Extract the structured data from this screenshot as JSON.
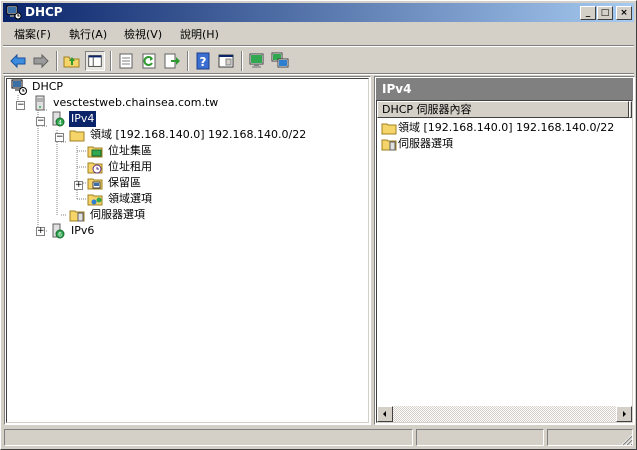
{
  "window": {
    "title": "DHCP",
    "controls": {
      "minimize": "_",
      "maximize": "□",
      "close": "×"
    }
  },
  "menu": [
    "檔案(F)",
    "執行(A)",
    "檢視(V)",
    "說明(H)"
  ],
  "toolbar": {
    "icons": [
      "back-arrow-icon",
      "forward-arrow-icon",
      "up-folder-icon",
      "show-tree-icon",
      "properties-icon",
      "refresh-icon",
      "export-icon",
      "help-icon",
      "console-tree-icon",
      "server-icon",
      "network-icon"
    ]
  },
  "tree": {
    "root": "DHCP",
    "server": "vesctestweb.chainsea.com.tw",
    "ipv4": "IPv4",
    "scope": "領域 [192.168.140.0] 192.168.140.0/22",
    "address_pool": "位址集區",
    "address_leases": "位址租用",
    "reservations": "保留區",
    "scope_options": "領域選項",
    "server_options": "伺服器選項",
    "ipv6": "IPv6"
  },
  "right_pane": {
    "header": "IPv4",
    "column": "DHCP 伺服器內容",
    "items": [
      "領域 [192.168.140.0] 192.168.140.0/22",
      "伺服器選項"
    ]
  },
  "colors": {
    "title_gradient_start": "#0a246a",
    "title_gradient_end": "#a6caf0",
    "selection": "#0a246a",
    "panel_header": "#808080",
    "face": "#d4d0c8"
  }
}
